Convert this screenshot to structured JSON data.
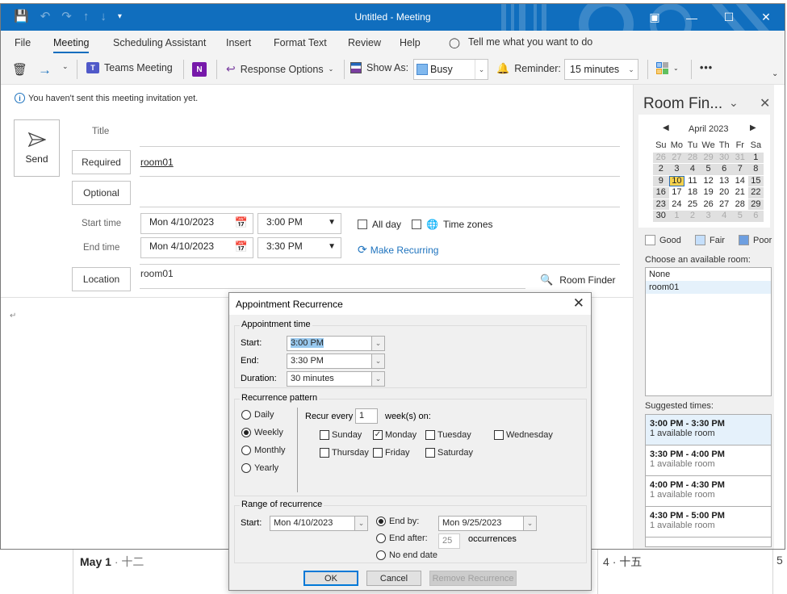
{
  "window": {
    "title": "Untitled  -  Meeting",
    "controls": [
      "restore-ribbon-icon",
      "minimize-icon",
      "maximize-icon",
      "close-icon"
    ]
  },
  "quick_access": [
    "save-icon",
    "undo-icon",
    "redo-icon",
    "up-arrow-icon",
    "down-arrow-icon",
    "customize-icon"
  ],
  "tabs": [
    {
      "label": "File"
    },
    {
      "label": "Meeting",
      "active": true
    },
    {
      "label": "Scheduling Assistant"
    },
    {
      "label": "Insert"
    },
    {
      "label": "Format Text"
    },
    {
      "label": "Review"
    },
    {
      "label": "Help"
    }
  ],
  "tell_me": "Tell me what you want to do",
  "ribbon": {
    "teams_meeting": "Teams Meeting",
    "response_options": "Response Options",
    "show_as_label": "Show As:",
    "show_as_value": "Busy",
    "reminder_label": "Reminder:",
    "reminder_value": "15 minutes",
    "more": "•••"
  },
  "form": {
    "info_message": "You haven't sent this meeting invitation yet.",
    "send_label": "Send",
    "title_label": "Title",
    "required_label": "Required",
    "required_value": "room01",
    "optional_label": "Optional",
    "start_time_label": "Start time",
    "start_date": "Mon 4/10/2023",
    "start_time": "3:00 PM",
    "end_time_label": "End time",
    "end_date": "Mon 4/10/2023",
    "end_time": "3:30 PM",
    "all_day_label": "All day",
    "time_zones_label": "Time zones",
    "make_recurring_label": "Make Recurring",
    "location_label": "Location",
    "location_value": "room01",
    "room_finder_label": "Room Finder",
    "body_mark": "↵"
  },
  "room_finder": {
    "title": "Room Fin...",
    "month": "April 2023",
    "weekdays": [
      "Su",
      "Mo",
      "Tu",
      "We",
      "Th",
      "Fr",
      "Sa"
    ],
    "weeks": [
      [
        "26",
        "27",
        "28",
        "29",
        "30",
        "31",
        "1"
      ],
      [
        "2",
        "3",
        "4",
        "5",
        "6",
        "7",
        "8"
      ],
      [
        "9",
        "10",
        "11",
        "12",
        "13",
        "14",
        "15"
      ],
      [
        "16",
        "17",
        "18",
        "19",
        "20",
        "21",
        "22"
      ],
      [
        "23",
        "24",
        "25",
        "26",
        "27",
        "28",
        "29"
      ],
      [
        "30",
        "1",
        "2",
        "3",
        "4",
        "5",
        "6"
      ]
    ],
    "selected_day": "10",
    "legend": [
      {
        "label": "Good",
        "color": "#ffffff"
      },
      {
        "label": "Fair",
        "color": "#c5dffb"
      },
      {
        "label": "Poor",
        "color": "#6e9fe0"
      }
    ],
    "choose_room_label": "Choose an available room:",
    "rooms": [
      "None",
      "room01"
    ],
    "selected_room": "room01",
    "suggested_label": "Suggested times:",
    "suggested": [
      {
        "time": "3:00 PM - 3:30 PM",
        "rooms": "1 available room",
        "selected": true
      },
      {
        "time": "3:30 PM - 4:00 PM",
        "rooms": "1 available room"
      },
      {
        "time": "4:00 PM - 4:30 PM",
        "rooms": "1 available room"
      },
      {
        "time": "4:30 PM - 5:00 PM",
        "rooms": "1 available room"
      }
    ]
  },
  "dialog": {
    "title": "Appointment Recurrence",
    "appointment_time": {
      "group_label": "Appointment time",
      "start_label": "Start:",
      "start_value": "3:00 PM",
      "end_label": "End:",
      "end_value": "3:30 PM",
      "duration_label": "Duration:",
      "duration_value": "30 minutes"
    },
    "pattern": {
      "group_label": "Recurrence pattern",
      "options": [
        "Daily",
        "Weekly",
        "Monthly",
        "Yearly"
      ],
      "selected": "Weekly",
      "recur_every_label": "Recur every",
      "recur_every_value": "1",
      "weeks_on_label": "week(s) on:",
      "days": [
        {
          "label": "Sunday",
          "checked": false
        },
        {
          "label": "Monday",
          "checked": true
        },
        {
          "label": "Tuesday",
          "checked": false
        },
        {
          "label": "Wednesday",
          "checked": false
        },
        {
          "label": "Thursday",
          "checked": false
        },
        {
          "label": "Friday",
          "checked": false
        },
        {
          "label": "Saturday",
          "checked": false
        }
      ]
    },
    "range": {
      "group_label": "Range of recurrence",
      "start_label": "Start:",
      "start_value": "Mon 4/10/2023",
      "end_by_label": "End by:",
      "end_by_value": "Mon 9/25/2023",
      "end_after_label": "End after:",
      "end_after_value": "25",
      "occurrences_label": "occurrences",
      "no_end_label": "No end date",
      "selected": "End by"
    },
    "buttons": {
      "ok": "OK",
      "cancel": "Cancel",
      "remove": "Remove Recurrence"
    }
  },
  "background_calendar": {
    "may1": "May 1",
    "may1_lunar": "· 十二",
    "day4": "4",
    "day4_lunar": "· 十五",
    "day5": "5"
  }
}
